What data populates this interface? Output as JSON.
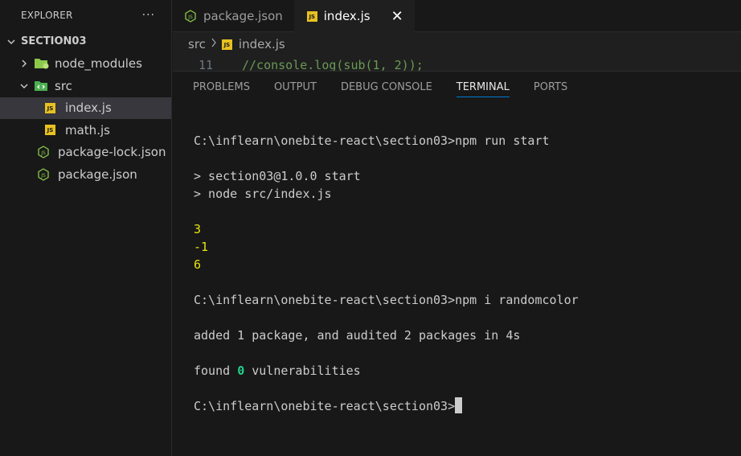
{
  "explorer": {
    "title": "EXPLORER",
    "more": "···",
    "section": "SECTION03",
    "tree": [
      {
        "label": "node_modules",
        "icon": "folder-node-icon"
      },
      {
        "label": "src",
        "icon": "folder-src-icon"
      },
      {
        "label": "index.js",
        "icon": "js-file-icon",
        "selected": true
      },
      {
        "label": "math.js",
        "icon": "js-file-icon"
      },
      {
        "label": "package-lock.json",
        "icon": "node-json-icon"
      },
      {
        "label": "package.json",
        "icon": "node-json-icon"
      }
    ]
  },
  "tabs": [
    {
      "label": "package.json",
      "active": false
    },
    {
      "label": "index.js",
      "active": true
    }
  ],
  "js_badge": "JS",
  "breadcrumb": {
    "folder": "src",
    "file": "index.js"
  },
  "code_peek": {
    "line_number": "11",
    "text": "//console.log(sub(1, 2));"
  },
  "panel_tabs": [
    "PROBLEMS",
    "OUTPUT",
    "DEBUG CONSOLE",
    "TERMINAL",
    "PORTS"
  ],
  "active_panel_tab": "TERMINAL",
  "terminal": {
    "cmd1_prompt": "C:\\inflearn\\onebite-react\\section03>",
    "cmd1": "npm run start",
    "out1": "> section03@1.0.0 start",
    "out2": "> node src/index.js",
    "val1": "3",
    "val2": "-1",
    "val3": "6",
    "cmd2_prompt": "C:\\inflearn\\onebite-react\\section03>",
    "cmd2": "npm i randomcolor",
    "added": "added 1 package, and audited 2 packages in 4s",
    "found_prefix": "found ",
    "found_count": "0",
    "found_suffix": " vulnerabilities",
    "final_prompt": "C:\\inflearn\\onebite-react\\section03>"
  },
  "colors": {
    "accent": "#0078d4",
    "js_icon": "#e8c121",
    "output_yellow": "#e5e510",
    "vuln_green": "#23d18b",
    "node_green": "#8cc84b"
  }
}
